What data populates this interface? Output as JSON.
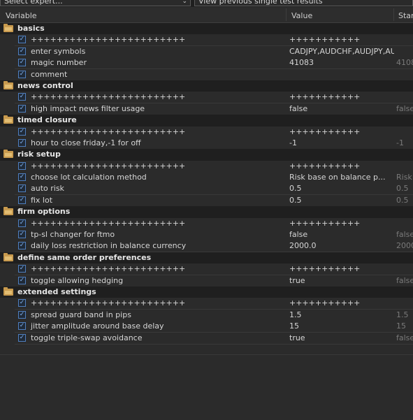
{
  "toolbar": {
    "expert_placeholder": "Select expert...",
    "results_button": "View previous single test results"
  },
  "columns": {
    "variable": "Variable",
    "value": "Value",
    "start": "Start"
  },
  "groups": [
    {
      "name": "basics",
      "params": [
        {
          "name": "++++++++++++++++++++++++",
          "value": "+++++++++++",
          "start": ""
        },
        {
          "name": "enter symbols",
          "value": "CADJPY,AUDCHF,AUDJPY,AUD",
          "start": ""
        },
        {
          "name": "magic number",
          "value": "41083",
          "start": "4108"
        },
        {
          "name": "comment",
          "value": "",
          "start": ""
        }
      ]
    },
    {
      "name": "news control",
      "params": [
        {
          "name": "++++++++++++++++++++++++",
          "value": "+++++++++++",
          "start": ""
        },
        {
          "name": "high impact news filter usage",
          "value": "false",
          "start": "false"
        }
      ]
    },
    {
      "name": "timed closure",
      "params": [
        {
          "name": "++++++++++++++++++++++++",
          "value": "+++++++++++",
          "start": ""
        },
        {
          "name": "hour to close friday,-1 for off",
          "value": "-1",
          "start": "-1"
        }
      ]
    },
    {
      "name": "risk setup",
      "params": [
        {
          "name": "++++++++++++++++++++++++",
          "value": "+++++++++++",
          "start": ""
        },
        {
          "name": "choose lot calculation method",
          "value": "Risk base on balance p...",
          "start": "Risk"
        },
        {
          "name": "auto risk",
          "value": "0.5",
          "start": "0.5"
        },
        {
          "name": "fix lot",
          "value": "0.5",
          "start": "0.5"
        }
      ]
    },
    {
      "name": "firm options",
      "params": [
        {
          "name": "++++++++++++++++++++++++",
          "value": "+++++++++++",
          "start": ""
        },
        {
          "name": "tp-sl changer for ftmo",
          "value": "false",
          "start": "false"
        },
        {
          "name": "daily loss restriction in balance currency",
          "value": "2000.0",
          "start": "2000"
        }
      ]
    },
    {
      "name": "define same order preferences",
      "params": [
        {
          "name": "++++++++++++++++++++++++",
          "value": "+++++++++++",
          "start": ""
        },
        {
          "name": "toggle allowing hedging",
          "value": "true",
          "start": "false"
        }
      ]
    },
    {
      "name": "extended settings",
      "params": [
        {
          "name": "++++++++++++++++++++++++",
          "value": "+++++++++++",
          "start": ""
        },
        {
          "name": "spread guard band in pips",
          "value": "1.5",
          "start": "1.5"
        },
        {
          "name": "jitter amplitude around base delay",
          "value": "15",
          "start": "15"
        },
        {
          "name": "toggle triple-swap avoidance",
          "value": "true",
          "start": "false"
        }
      ]
    }
  ]
}
